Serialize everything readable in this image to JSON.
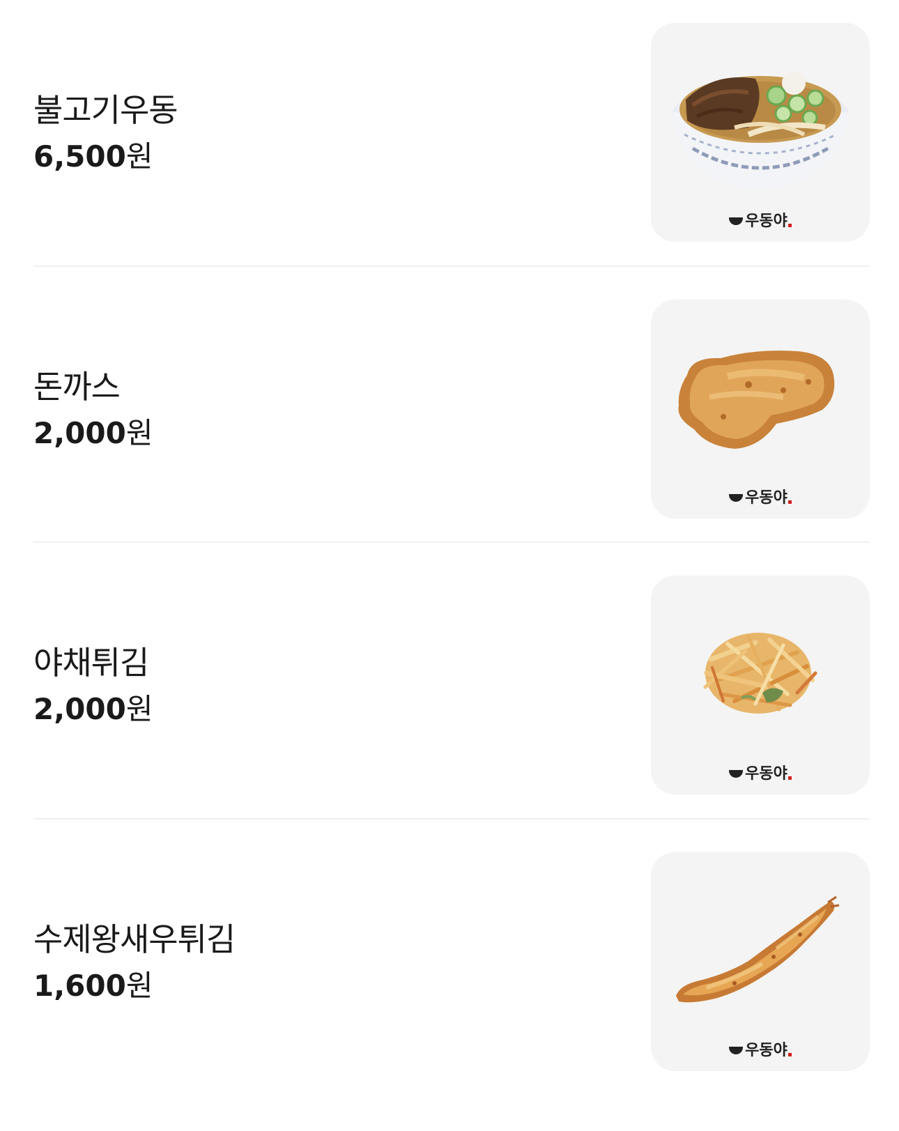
{
  "brand_label": "우동야",
  "items": [
    {
      "name": "불고기우동",
      "price": "6,500",
      "currency": "원",
      "image": "udon-bowl"
    },
    {
      "name": "돈까스",
      "price": "2,000",
      "currency": "원",
      "image": "pork-cutlet"
    },
    {
      "name": "야채튀김",
      "price": "2,000",
      "currency": "원",
      "image": "vegetable-tempura"
    },
    {
      "name": "수제왕새우튀김",
      "price": "1,600",
      "currency": "원",
      "image": "shrimp-tempura"
    }
  ]
}
